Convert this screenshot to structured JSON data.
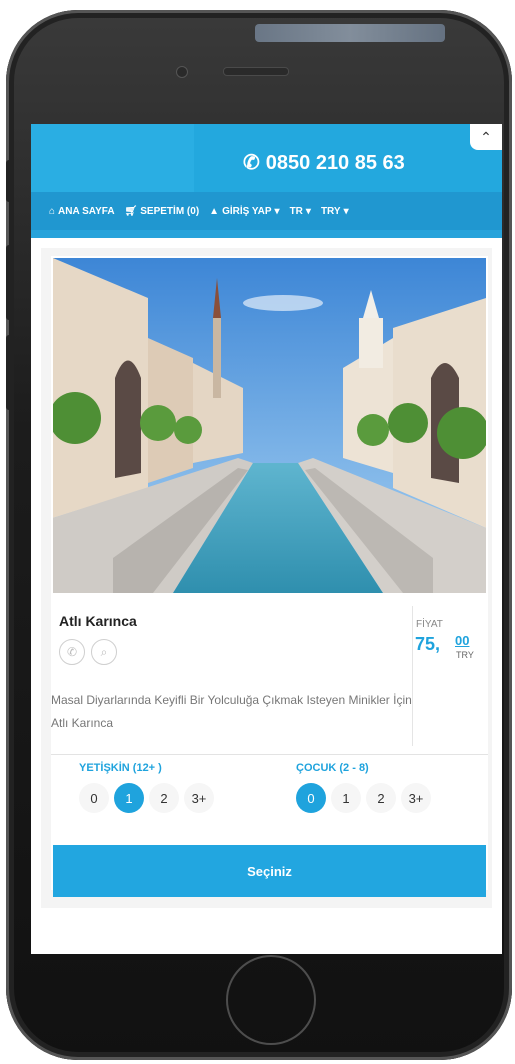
{
  "header": {
    "phone_number": "0850 210 85 63"
  },
  "nav": {
    "home": "ANA SAYFA",
    "cart": "SEPETİM (0)",
    "login": "GİRİŞ YAP",
    "language": "TR",
    "currency": "TRY"
  },
  "product": {
    "title": "Atlı Karınca",
    "price_label": "FİYAT",
    "price_int": "75,",
    "price_dec": "00",
    "price_currency": "TRY",
    "description": "Masal Diyarlarında Keyifli Bir Yolculuğa Çıkmak Isteyen Minikler İçin Atlı Karınca"
  },
  "adult": {
    "label": "YETİŞKİN (12+ )",
    "options": [
      "0",
      "1",
      "2",
      "3+"
    ],
    "selected": "1"
  },
  "child": {
    "label": "ÇOCUK (2 - 8)",
    "options": [
      "0",
      "1",
      "2",
      "3+"
    ],
    "selected": "0"
  },
  "select_button": "Seçiniz",
  "colors": {
    "accent": "#1fa3dd",
    "topbar": "#23a8de",
    "navbar": "#2097d0"
  },
  "icons": {
    "phone": "phone-icon",
    "home": "home-icon",
    "cart": "cart-icon",
    "user": "user-icon",
    "scroll_up": "chevron-up-icon",
    "search": "search-icon"
  }
}
